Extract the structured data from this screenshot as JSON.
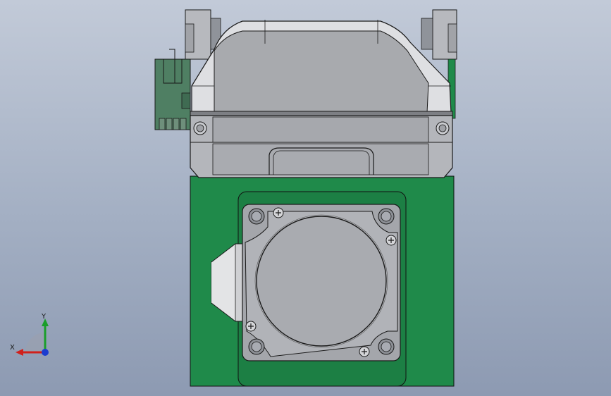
{
  "viewport": {
    "colors": {
      "pcb_green": "#1f8a4a",
      "pcb_green_dark": "#176e3a",
      "metal_light": "#dcdde0",
      "metal_mid": "#b9bbc0",
      "metal_face": "#a5a7ac",
      "edge": "#1a1a1a",
      "connector": "#4f7f63"
    },
    "parts": [
      "motor-housing",
      "pcb-board",
      "stepper-flange",
      "connector-header",
      "side-bracket-left",
      "side-bracket-right"
    ]
  },
  "triad": {
    "x_label": "X",
    "y_label": "Y",
    "colors": {
      "x": "#d0201c",
      "y": "#1a9e2a",
      "z": "#1c3ccf"
    }
  }
}
